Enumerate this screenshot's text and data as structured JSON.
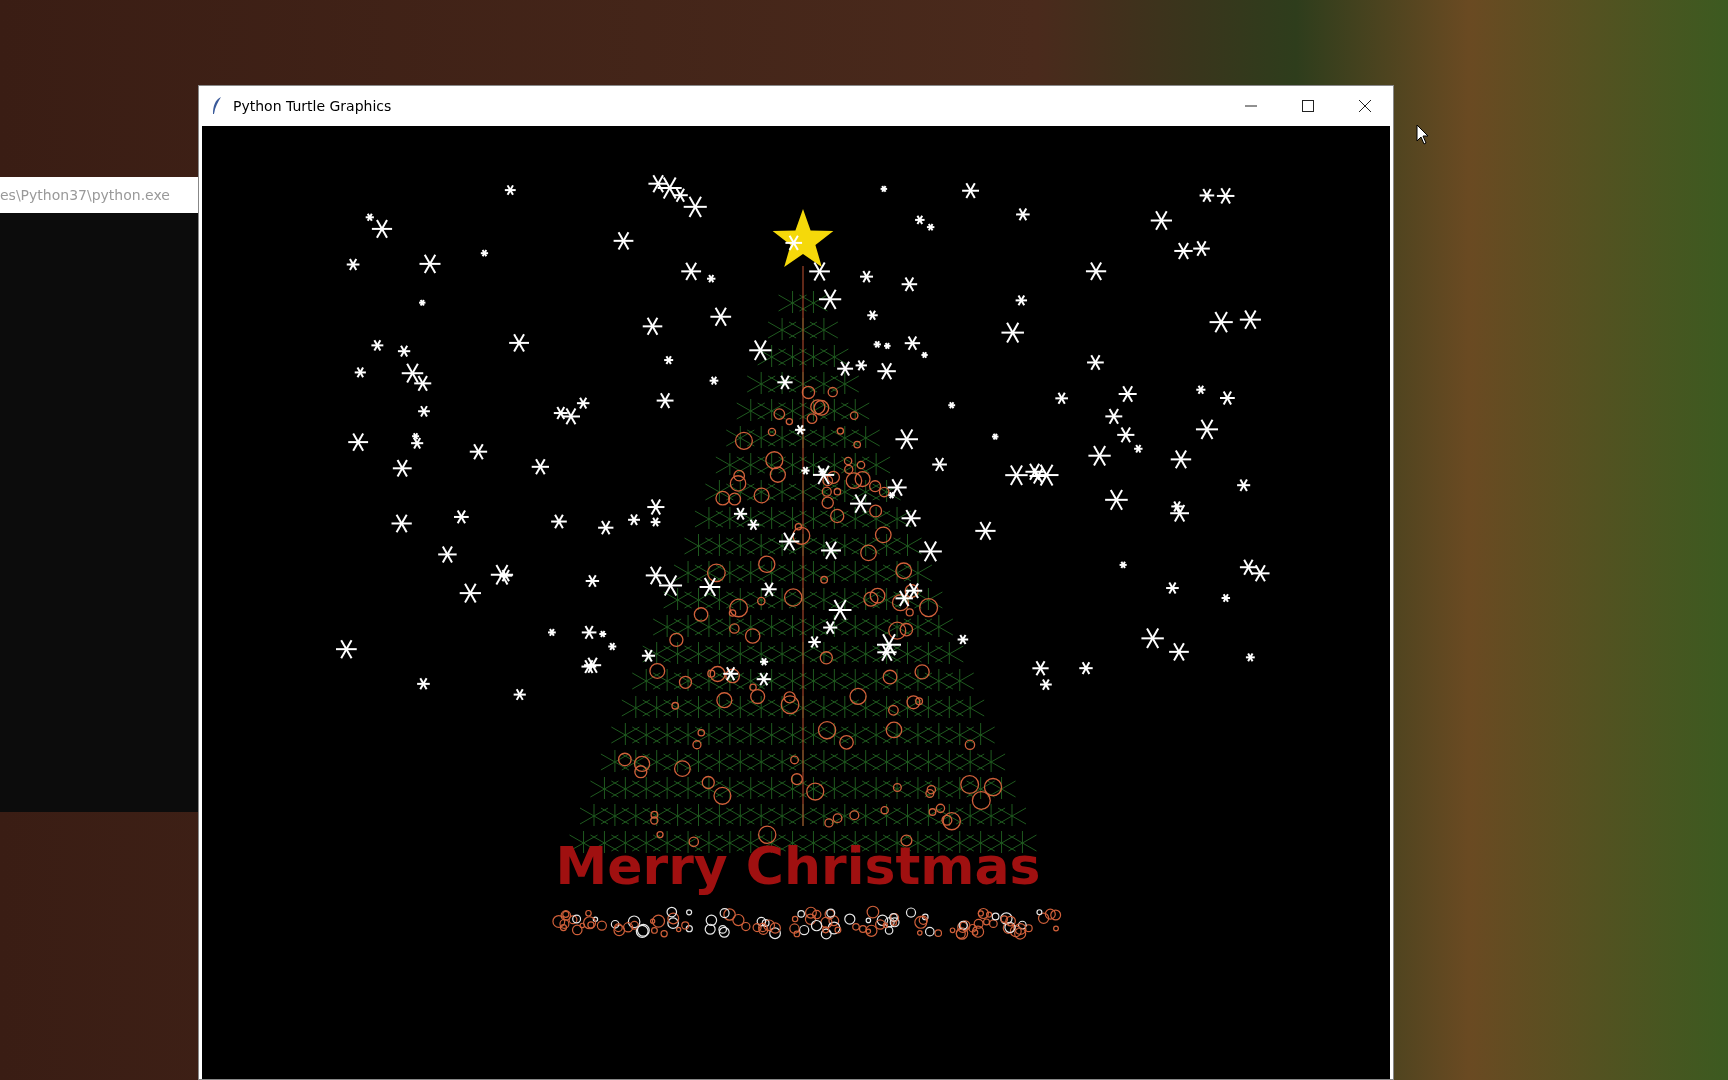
{
  "console_window": {
    "title": "es\\Python37\\python.exe"
  },
  "turtle_window": {
    "title": "Python Turtle Graphics",
    "greeting": "Merry Christmas"
  }
}
